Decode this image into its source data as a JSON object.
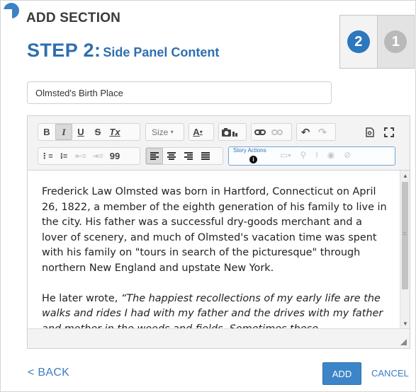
{
  "header": {
    "title": "ADD SECTION"
  },
  "step": {
    "label": "STEP 2:",
    "subtitle": "Side Panel Content"
  },
  "stepper": {
    "steps": [
      {
        "number": "2",
        "state": "active"
      },
      {
        "number": "1",
        "state": "inactive"
      }
    ]
  },
  "title_field": {
    "value": "Olmsted's Birth Place"
  },
  "toolbar": {
    "row1": [
      {
        "label": "B",
        "icon": "bold-icon"
      },
      {
        "label": "I",
        "icon": "italic-icon"
      },
      {
        "label": "U",
        "icon": "underline-icon"
      },
      {
        "label": "S",
        "icon": "strikethrough-icon"
      },
      {
        "label": "Tx",
        "icon": "remove-format-icon"
      },
      {
        "label": "Size",
        "icon": "font-size-dropdown"
      },
      {
        "label": "A",
        "icon": "text-color-icon"
      },
      {
        "label": "",
        "icon": "insert-media-icon"
      },
      {
        "label": "",
        "icon": "link-icon"
      },
      {
        "label": "",
        "icon": "unlink-icon"
      },
      {
        "label": "",
        "icon": "undo-icon"
      },
      {
        "label": "",
        "icon": "redo-icon"
      },
      {
        "label": "",
        "icon": "preview-icon"
      },
      {
        "label": "",
        "icon": "maximize-icon"
      }
    ],
    "row2": [
      {
        "label": "",
        "icon": "numbered-list-icon"
      },
      {
        "label": "",
        "icon": "bulleted-list-icon"
      },
      {
        "label": "",
        "icon": "outdent-icon"
      },
      {
        "label": "",
        "icon": "indent-icon"
      },
      {
        "label": "99",
        "icon": "blockquote-icon"
      },
      {
        "label": "",
        "icon": "align-left-icon"
      },
      {
        "label": "",
        "icon": "align-center-icon"
      },
      {
        "label": "",
        "icon": "align-right-icon"
      },
      {
        "label": "",
        "icon": "justify-icon"
      }
    ],
    "story_actions": {
      "label": "Story Actions",
      "info": "i"
    }
  },
  "content": {
    "paragraph1": "Frederick Law Olmsted was born in Hartford, Connecticut on April 26, 1822, a member of the eighth generation of his family to live in the city. His father was a successful dry-goods merchant and a lover of scenery, and much of Olmsted's vacation time was spent with his family on \"tours in search of the picturesque\" through northern New England and upstate New York.",
    "paragraph2_prefix": "He later wrote, ",
    "paragraph2_quote": "“The happiest recollections of my early life are the walks and rides I had with my father and the drives with my father and mother in the woods and fields. Sometimes these"
  },
  "footer": {
    "back_label": "< BACK",
    "add_label": "ADD",
    "cancel_label": "CANCEL"
  },
  "colors": {
    "accent": "#2e6fb0",
    "button": "#3c85c8",
    "step_active": "#2c77bd",
    "step_inactive": "#b9b9b9"
  }
}
